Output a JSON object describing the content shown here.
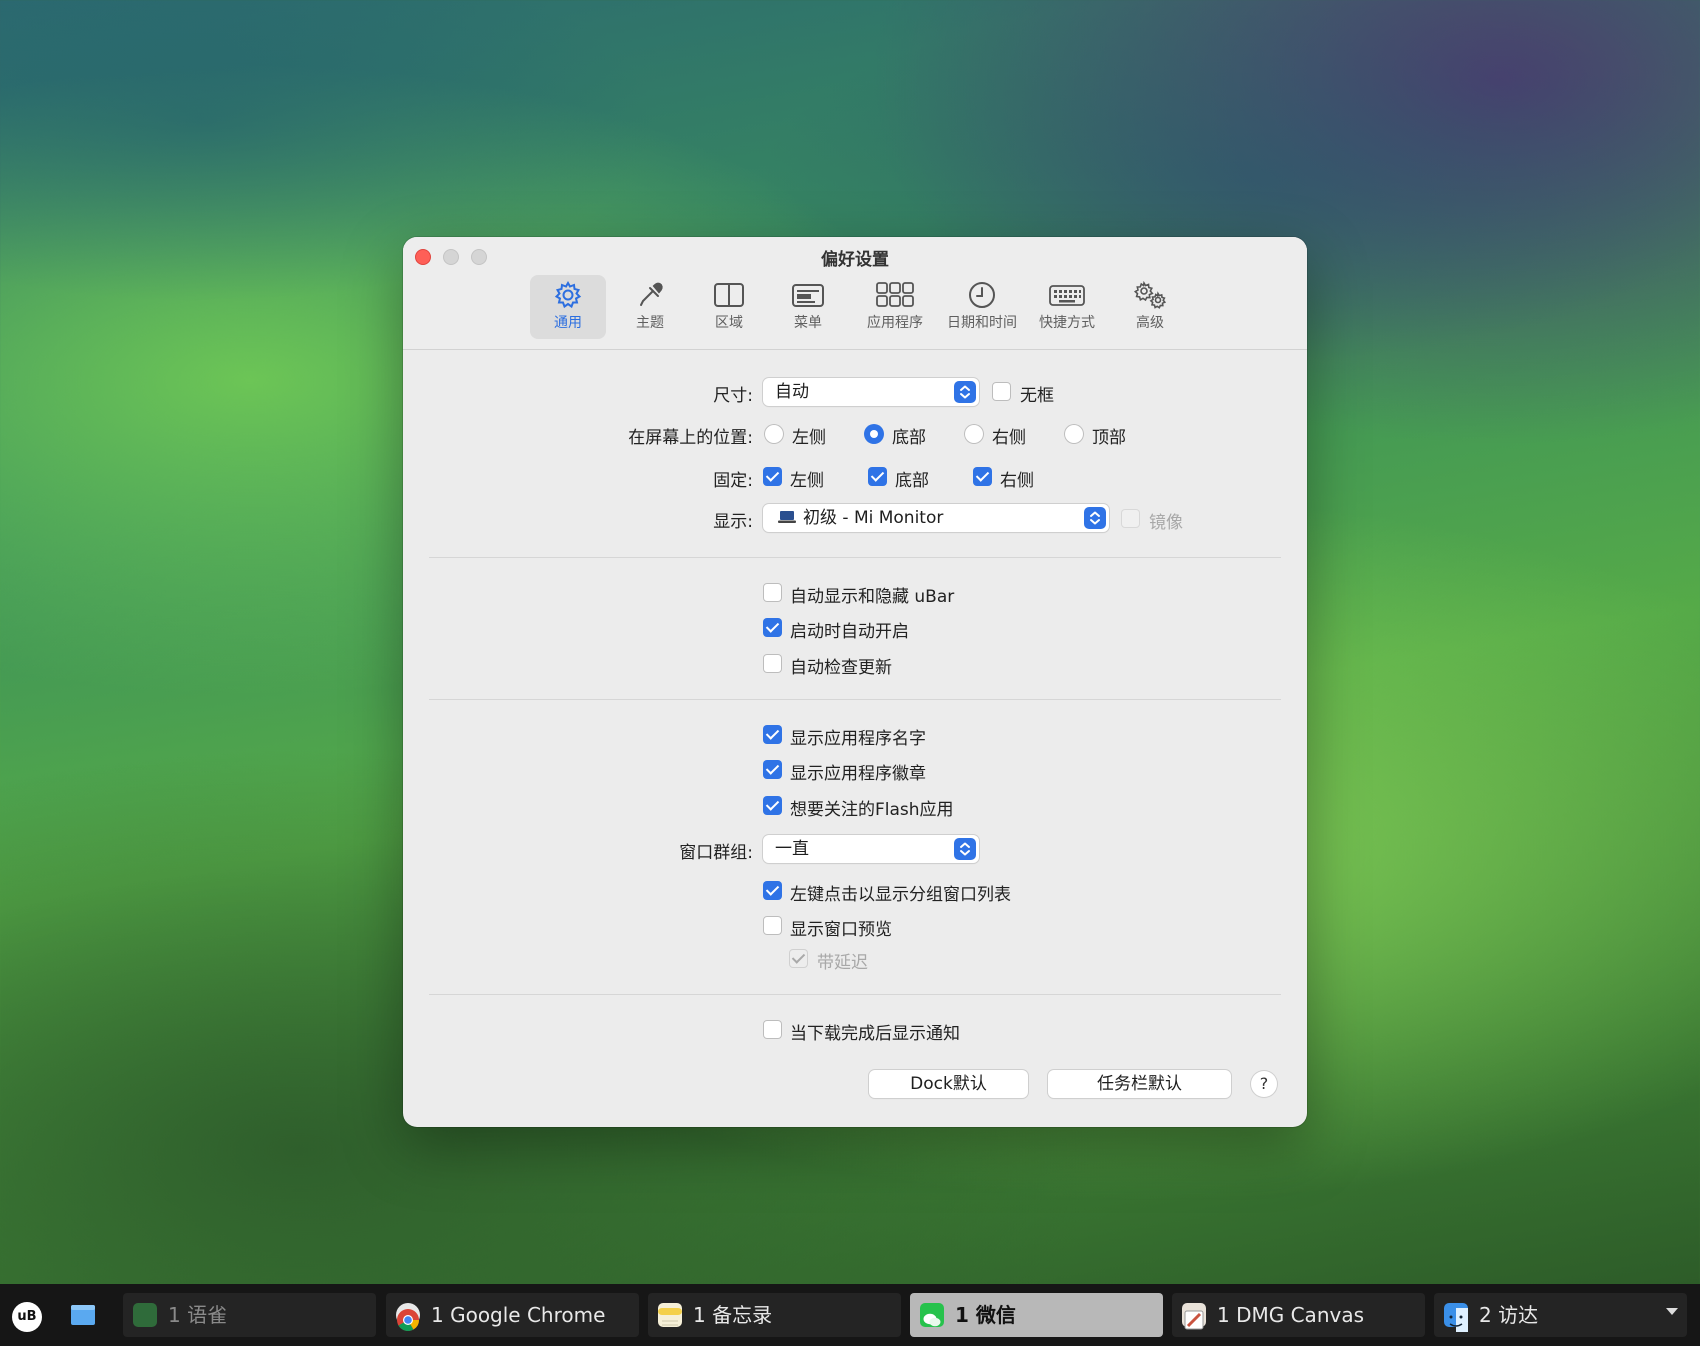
{
  "window": {
    "title": "偏好设置"
  },
  "toolbar": {
    "tabs": [
      {
        "label": "通用",
        "icon": "gear-icon"
      },
      {
        "label": "主题",
        "icon": "eyedropper-icon"
      },
      {
        "label": "区域",
        "icon": "split-view-icon"
      },
      {
        "label": "菜单",
        "icon": "menu-icon"
      },
      {
        "label": "应用程序",
        "icon": "app-grid-icon"
      },
      {
        "label": "日期和时间",
        "icon": "clock-icon"
      },
      {
        "label": "快捷方式",
        "icon": "keyboard-icon"
      },
      {
        "label": "高级",
        "icon": "gears-icon"
      }
    ],
    "active_tab": "通用"
  },
  "general": {
    "size": {
      "label": "尺寸:",
      "value": "自动",
      "frameless_label": "无框",
      "frameless": false
    },
    "position": {
      "label": "在屏幕上的位置:",
      "options": [
        "左侧",
        "底部",
        "右侧",
        "顶部"
      ],
      "selected": "底部"
    },
    "pin": {
      "label": "固定:",
      "options": [
        {
          "label": "左侧",
          "checked": true
        },
        {
          "label": "底部",
          "checked": true
        },
        {
          "label": "右侧",
          "checked": true
        }
      ]
    },
    "display": {
      "label": "显示:",
      "value": "初级 - Mi Monitor",
      "mirror_label": "镜像",
      "mirror": false
    },
    "group1": [
      {
        "label": "自动显示和隐藏 uBar",
        "checked": false
      },
      {
        "label": "启动时自动开启",
        "checked": true
      },
      {
        "label": "自动检查更新",
        "checked": false
      }
    ],
    "group2": [
      {
        "label": "显示应用程序名字",
        "checked": true
      },
      {
        "label": "显示应用程序徽章",
        "checked": true
      },
      {
        "label": "想要关注的Flash应用",
        "checked": true
      }
    ],
    "window_group": {
      "label": "窗口群组:",
      "value": "一直"
    },
    "group3": [
      {
        "label": "左键点击以显示分组窗口列表",
        "checked": true
      },
      {
        "label": "显示窗口预览",
        "checked": false
      }
    ],
    "delay": {
      "label": "带延迟",
      "checked": true,
      "enabled": false
    },
    "notify": {
      "label": "当下载完成后显示通知",
      "checked": false
    },
    "buttons": {
      "dock_default": "Dock默认",
      "taskbar_default": "任务栏默认",
      "help": "?"
    }
  },
  "taskbar": {
    "logo": "uB",
    "items": [
      {
        "label": "1 语雀",
        "state": "dim",
        "icon_color": "#2f6b3a"
      },
      {
        "label": "1 Google Chrome",
        "state": "normal",
        "icon_color": "#e8e8e8"
      },
      {
        "label": "1 备忘录",
        "state": "normal",
        "icon_color": "#f4d04b"
      },
      {
        "label": "1 微信",
        "state": "active",
        "icon_color": "#27c24c"
      },
      {
        "label": "1 DMG Canvas",
        "state": "normal",
        "icon_color": "#c9533f"
      },
      {
        "label": "2 访达",
        "state": "normal",
        "icon_color": "#3a8fe8"
      }
    ]
  },
  "colors": {
    "accent": "#2f73e6",
    "close": "#fe5f57"
  }
}
